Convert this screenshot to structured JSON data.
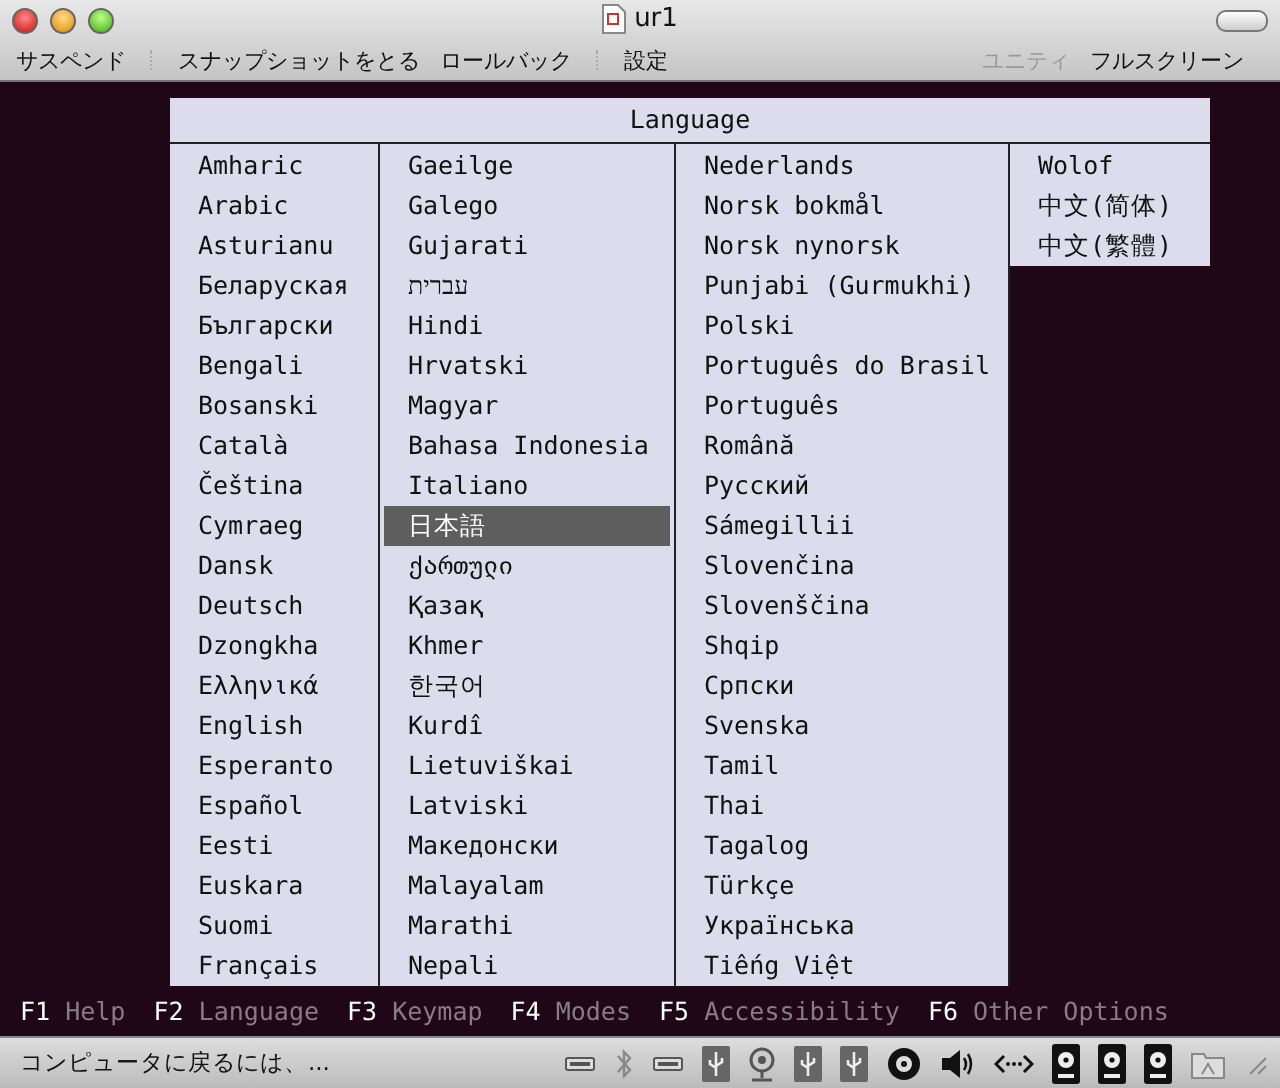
{
  "window": {
    "title": "ur1"
  },
  "toolbar": [
    {
      "items": [
        {
          "label": "サスペンド",
          "disabled": false
        }
      ]
    },
    {
      "items": [
        {
          "label": "スナップショットをとる",
          "disabled": false
        },
        {
          "label": "ロールバック",
          "disabled": false
        }
      ]
    },
    {
      "items": [
        {
          "label": "設定",
          "disabled": false
        }
      ]
    }
  ],
  "toolbar_right": [
    {
      "label": "ユニティ",
      "disabled": true
    },
    {
      "label": "フルスクリーン",
      "disabled": false
    }
  ],
  "menu": {
    "title": "Language",
    "columns": [
      {
        "items": [
          {
            "label": "Amharic",
            "selected": false
          },
          {
            "label": "Arabic",
            "selected": false
          },
          {
            "label": "Asturianu",
            "selected": false
          },
          {
            "label": "Беларуская",
            "selected": false
          },
          {
            "label": "Български",
            "selected": false
          },
          {
            "label": "Bengali",
            "selected": false
          },
          {
            "label": "Bosanski",
            "selected": false
          },
          {
            "label": "Català",
            "selected": false
          },
          {
            "label": "Čeština",
            "selected": false
          },
          {
            "label": "Cymraeg",
            "selected": false
          },
          {
            "label": "Dansk",
            "selected": false
          },
          {
            "label": "Deutsch",
            "selected": false
          },
          {
            "label": "Dzongkha",
            "selected": false
          },
          {
            "label": "Ελληνικά",
            "selected": false
          },
          {
            "label": "English",
            "selected": false
          },
          {
            "label": "Esperanto",
            "selected": false
          },
          {
            "label": "Español",
            "selected": false
          },
          {
            "label": "Eesti",
            "selected": false
          },
          {
            "label": "Euskara",
            "selected": false
          },
          {
            "label": "Suomi",
            "selected": false
          },
          {
            "label": "Français",
            "selected": false
          }
        ]
      },
      {
        "items": [
          {
            "label": "Gaeilge",
            "selected": false
          },
          {
            "label": "Galego",
            "selected": false
          },
          {
            "label": "Gujarati",
            "selected": false
          },
          {
            "label": "עברית",
            "selected": false
          },
          {
            "label": "Hindi",
            "selected": false
          },
          {
            "label": "Hrvatski",
            "selected": false
          },
          {
            "label": "Magyar",
            "selected": false
          },
          {
            "label": "Bahasa Indonesia",
            "selected": false
          },
          {
            "label": "Italiano",
            "selected": false
          },
          {
            "label": "日本語",
            "selected": true
          },
          {
            "label": "ქართული",
            "selected": false
          },
          {
            "label": "Қазақ",
            "selected": false
          },
          {
            "label": "Khmer",
            "selected": false
          },
          {
            "label": "한국어",
            "selected": false
          },
          {
            "label": "Kurdî",
            "selected": false
          },
          {
            "label": "Lietuviškai",
            "selected": false
          },
          {
            "label": "Latviski",
            "selected": false
          },
          {
            "label": "Македонски",
            "selected": false
          },
          {
            "label": "Malayalam",
            "selected": false
          },
          {
            "label": "Marathi",
            "selected": false
          },
          {
            "label": "Nepali",
            "selected": false
          }
        ]
      },
      {
        "items": [
          {
            "label": "Nederlands",
            "selected": false
          },
          {
            "label": "Norsk bokmål",
            "selected": false
          },
          {
            "label": "Norsk nynorsk",
            "selected": false
          },
          {
            "label": "Punjabi (Gurmukhi)",
            "selected": false
          },
          {
            "label": "Polski",
            "selected": false
          },
          {
            "label": "Português do Brasil",
            "selected": false
          },
          {
            "label": "Português",
            "selected": false
          },
          {
            "label": "Română",
            "selected": false
          },
          {
            "label": "Русский",
            "selected": false
          },
          {
            "label": "Sámegillii",
            "selected": false
          },
          {
            "label": "Slovenčina",
            "selected": false
          },
          {
            "label": "Slovenščina",
            "selected": false
          },
          {
            "label": "Shqip",
            "selected": false
          },
          {
            "label": "Српски",
            "selected": false
          },
          {
            "label": "Svenska",
            "selected": false
          },
          {
            "label": "Tamil",
            "selected": false
          },
          {
            "label": "Thai",
            "selected": false
          },
          {
            "label": "Tagalog",
            "selected": false
          },
          {
            "label": "Türkçe",
            "selected": false
          },
          {
            "label": "Українська",
            "selected": false
          },
          {
            "label": "Tiếng Việt",
            "selected": false
          }
        ]
      },
      {
        "items": [
          {
            "label": "Wolof",
            "selected": false
          },
          {
            "label": "中文(简体)",
            "selected": false
          },
          {
            "label": "中文(繁體)",
            "selected": false
          }
        ]
      }
    ]
  },
  "function_keys": [
    {
      "key": "F1",
      "label": "Help"
    },
    {
      "key": "F2",
      "label": "Language"
    },
    {
      "key": "F3",
      "label": "Keymap"
    },
    {
      "key": "F4",
      "label": "Modes"
    },
    {
      "key": "F5",
      "label": "Accessibility"
    },
    {
      "key": "F6",
      "label": "Other Options"
    }
  ],
  "status_bar": {
    "text": "コンピュータに戻るには、..."
  }
}
